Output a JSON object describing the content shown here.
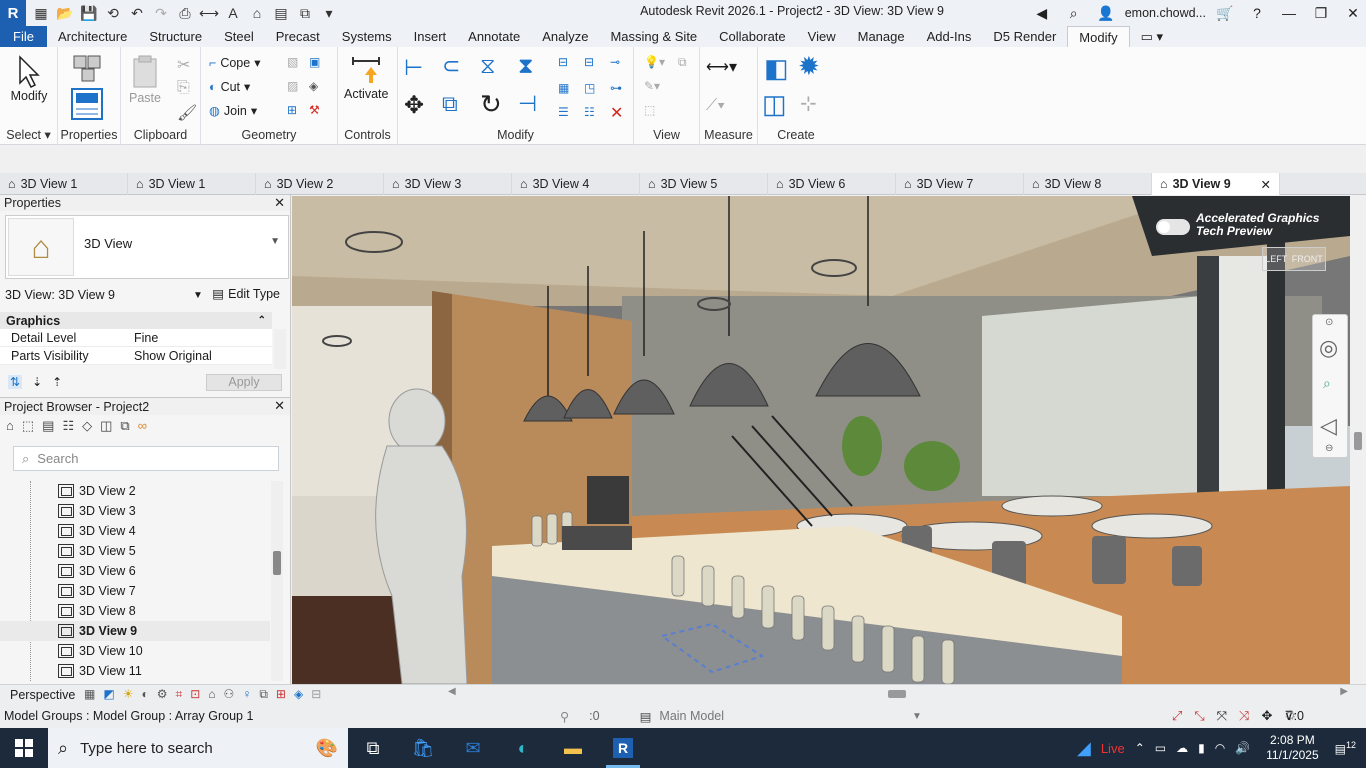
{
  "window": {
    "title": "Autodesk Revit 2026.1 - Project2 - 3D View: 3D View 9",
    "user": "emon.chowd...",
    "logo": "R"
  },
  "ribbon_tabs": [
    "File",
    "Architecture",
    "Structure",
    "Steel",
    "Precast",
    "Systems",
    "Insert",
    "Annotate",
    "Analyze",
    "Massing & Site",
    "Collaborate",
    "View",
    "Manage",
    "Add-Ins",
    "D5 Render",
    "Modify"
  ],
  "ribbon": {
    "select": {
      "modify": "Modify",
      "title": "Select"
    },
    "properties": {
      "title": "Properties"
    },
    "clipboard": {
      "paste": "Paste",
      "title": "Clipboard"
    },
    "geometry": {
      "cope": "Cope",
      "cut": "Cut",
      "join": "Join",
      "title": "Geometry"
    },
    "controls": {
      "activate": "Activate",
      "title": "Controls"
    },
    "modify": {
      "title": "Modify"
    },
    "view": {
      "title": "View"
    },
    "measure": {
      "title": "Measure"
    },
    "create": {
      "title": "Create"
    }
  },
  "view_tabs": [
    "3D View 1",
    "3D View 1",
    "3D View 2",
    "3D View 3",
    "3D View 4",
    "3D View 5",
    "3D View 6",
    "3D View 7",
    "3D View 8",
    "3D View 9"
  ],
  "properties": {
    "header": "Properties",
    "type_name": "3D View",
    "instance": "3D View: 3D View 9",
    "edit_type": "Edit Type",
    "category": "Graphics",
    "rows": [
      {
        "k": "Detail Level",
        "v": "Fine"
      },
      {
        "k": "Parts Visibility",
        "v": "Show Original"
      }
    ],
    "apply": "Apply"
  },
  "browser": {
    "header": "Project Browser - Project2",
    "search_placeholder": "Search",
    "items": [
      "3D View 2",
      "3D View 3",
      "3D View 4",
      "3D View 5",
      "3D View 6",
      "3D View 7",
      "3D View 8",
      "3D View 9",
      "3D View 10",
      "3D View 11"
    ],
    "selected": "3D View 9"
  },
  "viewport": {
    "accel_line1": "Accelerated Graphics",
    "accel_line2": "Tech Preview",
    "cube_left": "LEFT",
    "cube_front": "FRONT"
  },
  "view_control": {
    "mode": "Perspective"
  },
  "status": {
    "message": "Model Groups : Model Group : Array Group 1",
    "zero_left": ":0",
    "model": "Main Model",
    "filter_count": ":0"
  },
  "taskbar": {
    "search_placeholder": "Type here to search",
    "live": "Live",
    "time": "2:08 PM",
    "date": "11/1/2025",
    "notifications": "12"
  },
  "colors": {
    "file_tab": "#1d5fb0",
    "taskbar": "#1c2a3b",
    "accent_blue": "#1d73c9"
  }
}
